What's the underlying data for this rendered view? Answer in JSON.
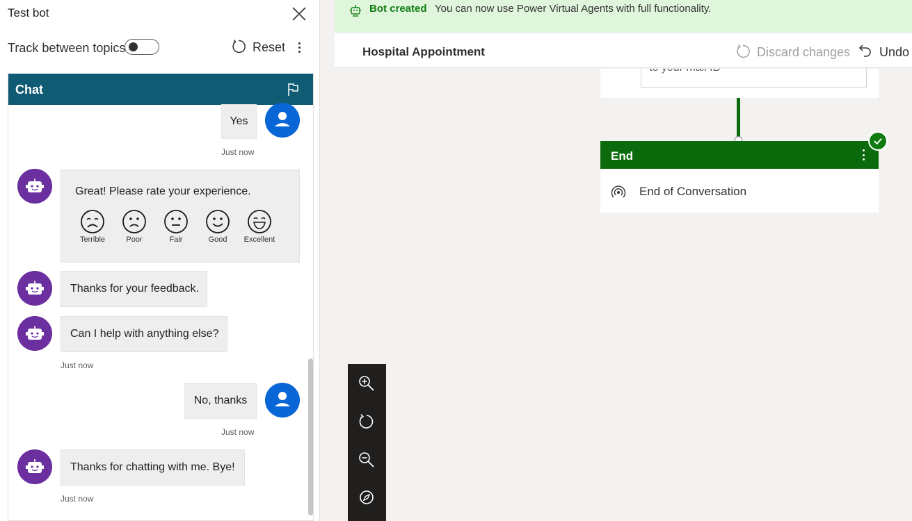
{
  "test_pane": {
    "title": "Test bot",
    "track_label": "Track between topics",
    "track_toggle_on": false,
    "reset_label": "Reset"
  },
  "chat": {
    "header": "Chat",
    "user_msg_1": "Yes",
    "ts_1": "Just now",
    "rating_prompt": "Great! Please rate your experience.",
    "ratings": [
      "Terrible",
      "Poor",
      "Fair",
      "Good",
      "Excellent"
    ],
    "bot_msg_1": "Thanks for your feedback.",
    "bot_msg_2": "Can I help with anything else?",
    "ts_2": "Just now",
    "user_msg_2": "No, thanks",
    "ts_3": "Just now",
    "bot_msg_3": "Thanks for chatting with me. Bye!",
    "ts_4": "Just now"
  },
  "banner": {
    "title": "Bot created",
    "text": "You can now use Power Virtual Agents with full functionality."
  },
  "topic_bar": {
    "title": "Hospital Appointment",
    "discard_label": "Discard changes",
    "undo_label": "Undo"
  },
  "canvas": {
    "prev_node_text": "to your mail ID",
    "end_node_title": "End",
    "end_node_action": "End of Conversation"
  },
  "colors": {
    "chat_header": "#0e5b73",
    "bot_avatar": "#6b2fa0",
    "user_avatar": "#0866d6",
    "end_node": "#0b6a0b",
    "banner_bg": "#dff6dd",
    "banner_title": "#107c10"
  },
  "icons": {
    "close": "close-icon",
    "reset": "refresh-icon",
    "flag": "flag-icon",
    "bot": "bot-icon",
    "user": "person-icon",
    "zoom_in": "zoom-in-icon",
    "zoom_reset": "refresh-icon",
    "zoom_out": "zoom-out-icon",
    "compass": "compass-icon"
  }
}
